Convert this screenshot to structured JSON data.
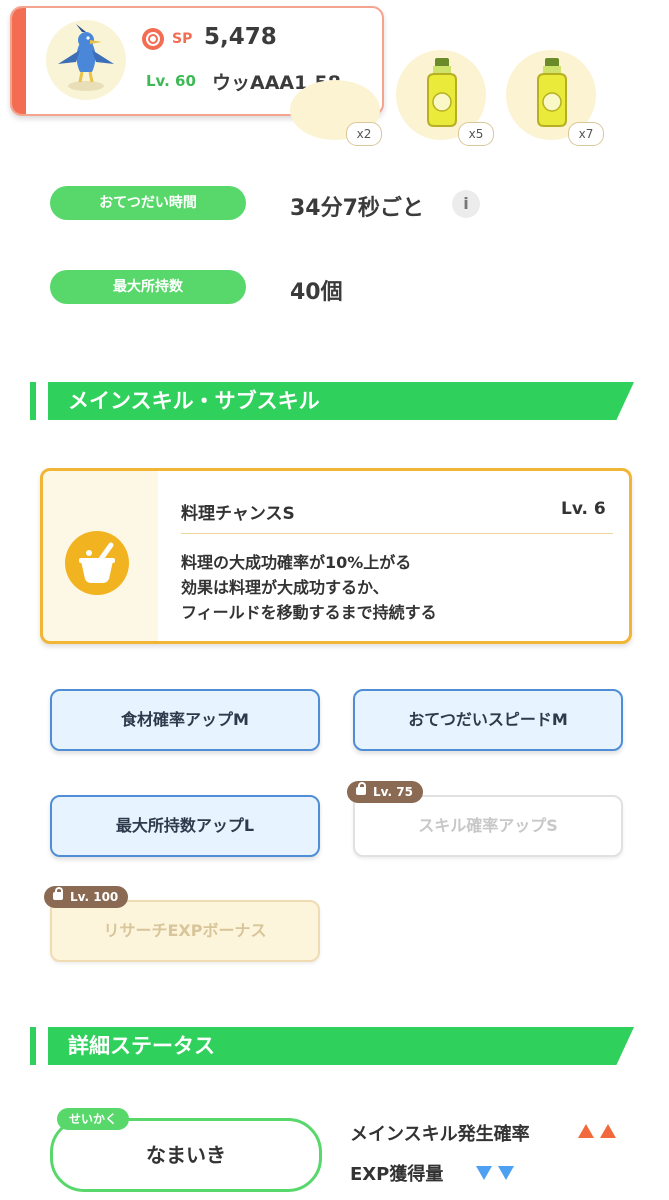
{
  "header": {
    "sp_label": "SP",
    "sp_value": "5,478",
    "level": "Lv. 60",
    "name": "ウッAAA1.58"
  },
  "ingredients": [
    {
      "icon": "ingredient-icon",
      "count": "x2"
    },
    {
      "icon": "oil-bottle-icon",
      "count": "x5"
    },
    {
      "icon": "oil-bottle-icon",
      "count": "x7"
    }
  ],
  "info": {
    "help_time_label": "おてつだい時間",
    "help_time_value": "34分7秒ごと",
    "info_icon": "i",
    "max_carry_label": "最大所持数",
    "max_carry_value": "40個"
  },
  "skills_section": {
    "title": "メインスキル・サブスキル",
    "main_skill": {
      "name": "料理チャンスS",
      "level": "Lv. 6",
      "description": [
        "料理の大成功確率が10%上がる",
        "効果は料理が大成功するか、",
        "フィールドを移動するまで持続する"
      ]
    },
    "sub_skills": [
      {
        "label": "食材確率アップM",
        "locked": false
      },
      {
        "label": "おてつだいスピードM",
        "locked": false
      },
      {
        "label": "最大所持数アップL",
        "locked": false
      },
      {
        "label": "スキル確率アップS",
        "locked": true,
        "unlock": "Lv. 75"
      },
      {
        "label": "リサーチEXPボーナス",
        "locked": true,
        "unlock": "Lv. 100"
      }
    ]
  },
  "details_section": {
    "title": "詳細ステータス",
    "nature_tag": "せいかく",
    "nature": "なまいき",
    "stats": [
      {
        "label": "メインスキル発生確率",
        "effect": "up-up"
      },
      {
        "label": "EXP獲得量",
        "effect": "down-down"
      }
    ]
  },
  "colors": {
    "accent_green": "#2fd15c",
    "pill_green": "#58d86b",
    "sp_orange": "#f36d52",
    "skill_gold": "#f1b635",
    "sub_blue": "#4f8ed6",
    "up_color": "#f26a3c",
    "down_color": "#4ea0f2"
  }
}
